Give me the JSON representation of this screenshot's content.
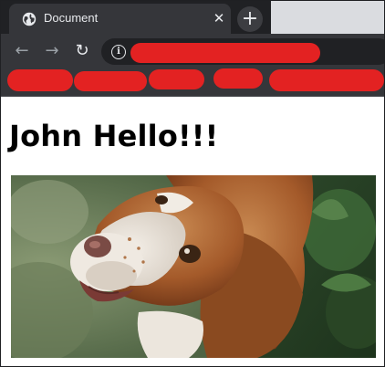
{
  "browser": {
    "tab_title": "Document",
    "close_glyph": "✕",
    "new_tab_glyph": "+",
    "back_glyph": "←",
    "forward_glyph": "→",
    "reload_glyph": "↻",
    "info_glyph": "i"
  },
  "page": {
    "heading": "John Hello!!!",
    "image": {
      "subject": "dog-photo"
    }
  },
  "colors": {
    "tab_strip": "#202124",
    "toolbar": "#35363a",
    "redaction": "#e32222"
  }
}
